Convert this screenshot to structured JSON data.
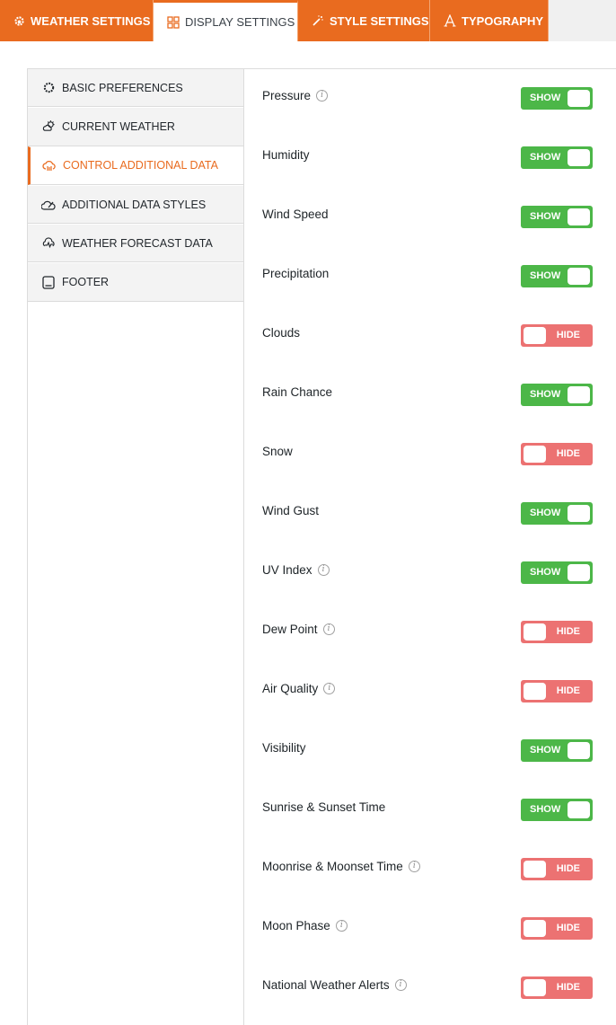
{
  "tabs": [
    {
      "label": "WEATHER SETTINGS",
      "icon": "weather-gear-icon",
      "active": false
    },
    {
      "label": "DISPLAY SETTINGS",
      "icon": "grid-icon",
      "active": true
    },
    {
      "label": "STYLE SETTINGS",
      "icon": "magic-wand-icon",
      "active": false
    },
    {
      "label": "TYPOGRAPHY",
      "icon": "typography-icon",
      "active": false
    }
  ],
  "sidebar": {
    "items": [
      {
        "label": "BASIC PREFERENCES",
        "icon": "sun-moon-icon",
        "active": false
      },
      {
        "label": "CURRENT WEATHER",
        "icon": "partly-cloudy-icon",
        "active": false
      },
      {
        "label": "CONTROL ADDITIONAL DATA",
        "icon": "cloud-data-icon",
        "active": true
      },
      {
        "label": "ADDITIONAL DATA STYLES",
        "icon": "cloud-brush-icon",
        "active": false
      },
      {
        "label": "WEATHER FORECAST DATA",
        "icon": "forecast-icon",
        "active": false
      },
      {
        "label": "FOOTER",
        "icon": "footer-icon",
        "active": false
      }
    ]
  },
  "toggle_labels": {
    "on": "SHOW",
    "off": "HIDE"
  },
  "settings": [
    {
      "label": "Pressure",
      "info": true,
      "state": "on"
    },
    {
      "label": "Humidity",
      "info": false,
      "state": "on"
    },
    {
      "label": "Wind Speed",
      "info": false,
      "state": "on"
    },
    {
      "label": "Precipitation",
      "info": false,
      "state": "on"
    },
    {
      "label": "Clouds",
      "info": false,
      "state": "off"
    },
    {
      "label": "Rain Chance",
      "info": false,
      "state": "on"
    },
    {
      "label": "Snow",
      "info": false,
      "state": "off"
    },
    {
      "label": "Wind Gust",
      "info": false,
      "state": "on"
    },
    {
      "label": "UV Index",
      "info": true,
      "state": "on"
    },
    {
      "label": "Dew Point",
      "info": true,
      "state": "off"
    },
    {
      "label": "Air Quality",
      "info": true,
      "state": "off"
    },
    {
      "label": "Visibility",
      "info": false,
      "state": "on"
    },
    {
      "label": "Sunrise & Sunset Time",
      "info": false,
      "state": "on"
    },
    {
      "label": "Moonrise & Moonset Time",
      "info": true,
      "state": "off"
    },
    {
      "label": "Moon Phase",
      "info": true,
      "state": "off"
    },
    {
      "label": "National Weather Alerts",
      "info": true,
      "state": "off"
    }
  ],
  "colors": {
    "accent": "#e96b1f",
    "show": "#4cb748",
    "hide": "#ec7272"
  }
}
